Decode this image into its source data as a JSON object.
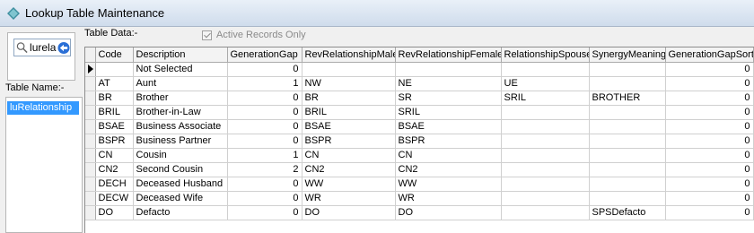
{
  "window": {
    "title": "Lookup Table Maintenance"
  },
  "search": {
    "value": "lurela"
  },
  "left": {
    "table_name_label": "Table Name:-",
    "tables": [
      "luRelationship"
    ]
  },
  "data_panel": {
    "label": "Table Data:-",
    "active_only_label": "Active Records Only",
    "active_only_checked": true
  },
  "grid": {
    "columns": [
      "Code",
      "Description",
      "GenerationGap",
      "RevRelationshipMale",
      "RevRelationshipFemale",
      "RelationshipSpouse",
      "SynergyMeaning",
      "GenerationGapSort"
    ],
    "rows": [
      [
        "",
        "Not Selected",
        "0",
        "",
        "",
        "",
        "",
        "0"
      ],
      [
        "AT",
        "Aunt",
        "1",
        "NW",
        "NE",
        "UE",
        "",
        "0"
      ],
      [
        "BR",
        "Brother",
        "0",
        "BR",
        "SR",
        "SRIL",
        "BROTHER",
        "0"
      ],
      [
        "BRIL",
        "Brother-in-Law",
        "0",
        "BRIL",
        "SRIL",
        "",
        "",
        "0"
      ],
      [
        "BSAE",
        "Business Associate",
        "0",
        "BSAE",
        "BSAE",
        "",
        "",
        "0"
      ],
      [
        "BSPR",
        "Business Partner",
        "0",
        "BSPR",
        "BSPR",
        "",
        "",
        "0"
      ],
      [
        "CN",
        "Cousin",
        "1",
        "CN",
        "CN",
        "",
        "",
        "0"
      ],
      [
        "CN2",
        "Second Cousin",
        "2",
        "CN2",
        "CN2",
        "",
        "",
        "0"
      ],
      [
        "DECH",
        "Deceased Husband",
        "0",
        "WW",
        "WW",
        "",
        "",
        "0"
      ],
      [
        "DECW",
        "Deceased Wife",
        "0",
        "WR",
        "WR",
        "",
        "",
        "0"
      ],
      [
        "DO",
        "Defacto",
        "0",
        "DO",
        "DO",
        "",
        "SPSDefacto",
        "0"
      ]
    ]
  }
}
